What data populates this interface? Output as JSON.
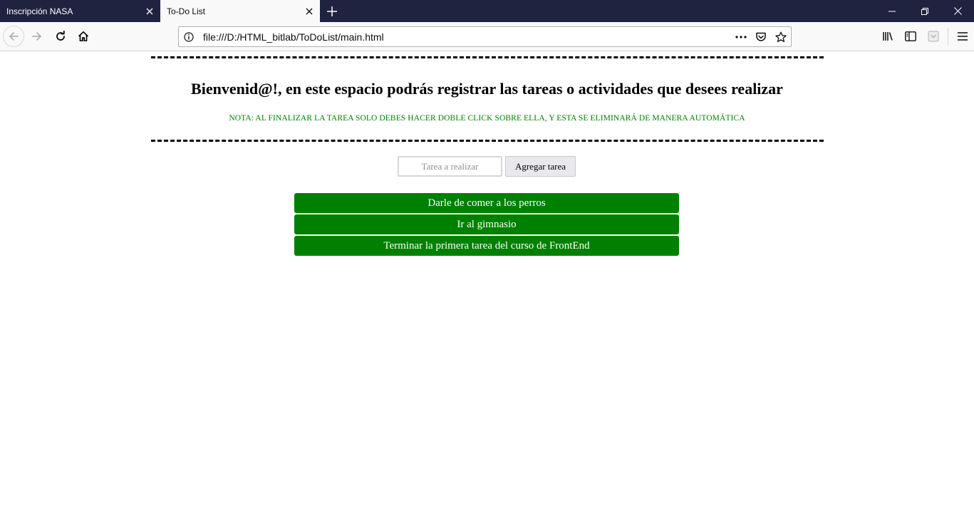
{
  "browser": {
    "tabs": [
      {
        "title": "Inscripción NASA",
        "active": false
      },
      {
        "title": "To-Do List",
        "active": true
      }
    ],
    "url": "file:///D:/HTML_bitlab/ToDoList/main.html",
    "icons": {
      "back": "arrow-left-icon",
      "forward": "arrow-right-icon",
      "reload": "reload-icon",
      "home": "home-icon",
      "info": "info-icon",
      "page_actions": "ellipsis-icon",
      "pocket": "pocket-icon",
      "bookmark": "star-icon",
      "library": "library-icon",
      "sidebar": "sidebar-icon",
      "menu": "hamburger-menu-icon"
    },
    "colors": {
      "tabstrip": "#202340",
      "toolbar": "#f9f9fa"
    }
  },
  "page": {
    "heading": "Bienvenid@!, en este espacio podrás registrar las tareas o actividades que desees realizar",
    "note": "NOTA: AL FINALIZAR LA TAREA SOLO DEBES HACER DOBLE CLICK SOBRE ELLA, Y ESTA SE ELIMINARÁ DE MANERA AUTOMÁTICA",
    "input": {
      "placeholder": "Tarea a realizar",
      "value": ""
    },
    "add_button": "Agregar tarea",
    "tasks": [
      "Darle de comer a los perros",
      "Ir al gimnasio",
      "Terminar la primera tarea del curso de FrontEnd"
    ],
    "colors": {
      "task_background": "#008000",
      "note_text": "#008000"
    }
  }
}
